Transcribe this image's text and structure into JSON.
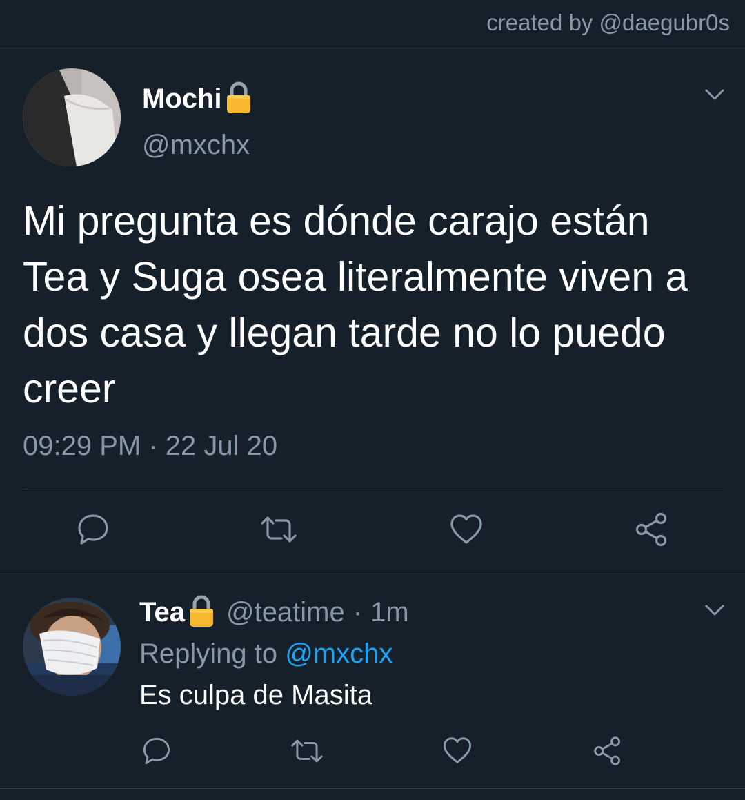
{
  "header": {
    "credit": "created by @daegubr0s"
  },
  "main_tweet": {
    "display_name": "Mochi",
    "handle": "@mxchx",
    "text": "Mi pregunta es dónde carajo están Tea y Suga osea literalmente viven a dos casa y llegan tarde no lo puedo creer",
    "time": "09:29 PM",
    "separator": "·",
    "date": "22 Jul 20",
    "icons": {
      "lock": "lock-icon",
      "menu": "chevron-down-icon",
      "reply": "comment-icon",
      "retweet": "retweet-icon",
      "like": "heart-icon",
      "share": "share-icon"
    }
  },
  "reply_tweet": {
    "display_name": "Tea",
    "handle": "@teatime",
    "separator": "·",
    "age": "1m",
    "replying_prefix": "Replying to",
    "replying_to": "@mxchx",
    "text": "Es culpa de Masita"
  },
  "colors": {
    "background": "#15202b",
    "divider": "#38444d",
    "secondary_text": "#8899a6",
    "primary_text": "#ffffff",
    "link": "#1da1f2",
    "lock": "#f5b82e"
  }
}
